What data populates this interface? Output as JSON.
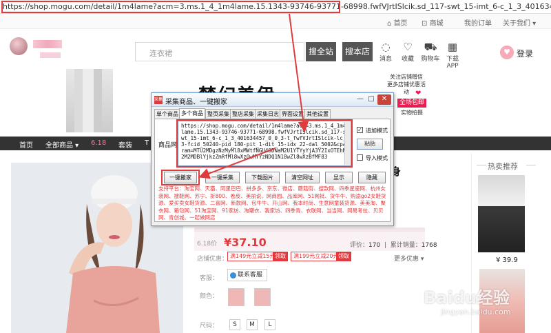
{
  "browser": {
    "url": "https://shop.mogu.com/detail/1m4lame?acm=3.ms.1_4_1m4lame.15.1343-93746-93771-68998.fwfVJrtISlcik.sd_117-swt_15-imt_6-c_1_3_401634457_0_0_3-t_fwfVJrtISlcik-lc_3-fcid_5024..."
  },
  "toplinks": [
    {
      "label": "首页",
      "icon": "home-icon"
    },
    {
      "label": "商城",
      "icon": "cart-icon"
    },
    {
      "label": "我的订单"
    },
    {
      "label": "关于我们"
    }
  ],
  "header": {
    "search_placeholder": "连衣裙",
    "search_all_label": "搜全站",
    "search_shop_label": "搜本店",
    "icons": [
      {
        "label": "消息",
        "icon": "chat-icon",
        "glyph": "◌"
      },
      {
        "label": "收藏",
        "icon": "heart-icon",
        "glyph": "♡"
      },
      {
        "label": "购物车",
        "icon": "cart-icon",
        "glyph": "⛟"
      },
      {
        "label": "下载APP",
        "icon": "qr-icon",
        "glyph": "▦"
      }
    ],
    "login_label": "登录"
  },
  "banner": {
    "title": "梦幻美伊",
    "promo_line1": "关注店铺赠信",
    "promo_line2": "更多店铺优惠活动",
    "promo_button": "全场包邮",
    "promo_sub": "实物拍摄"
  },
  "nav": {
    "items": [
      "首页",
      "全部商品 ▾",
      "6.18",
      "套装",
      "T"
    ]
  },
  "product": {
    "title_tail": "挤修身",
    "price_label": "6.18价",
    "price": "¥37.10",
    "eval_label": "评价：",
    "eval_count": "170",
    "sales_label": "累计销量：",
    "sales_count": "1768",
    "coupon_label": "店铺优惠：",
    "coupons": [
      {
        "text": "满149元立减15元",
        "tag": "领取"
      },
      {
        "text": "满199元立减20元",
        "tag": "领取"
      }
    ],
    "more_label": "更多优惠 ▾",
    "service_label": "客服：",
    "service_button": "联系客服",
    "color_label": "颜色：",
    "size_label": "尺码：",
    "sizes": [
      "S",
      "M",
      "L"
    ]
  },
  "hot": {
    "title": "热卖推荐",
    "price1": "¥ 39.9"
  },
  "dialog": {
    "title": "采集商品、一键搬家",
    "icon_text": "采集",
    "tabs": [
      "单个商品",
      "多个商品",
      "整页采集",
      "整店采集",
      "采集日志",
      "界面设置",
      "其他设置"
    ],
    "url_label": "商品网址:",
    "url_value": "https://shop.mogu.com/detail/1m4lame?acm=3.ms.1_4_1m4lame.15.1343-93746-93771-68998.fwfVJrtISlcik.sd_117-swt_15-imt_6-c_1_3_401634457_0_0_3-t_fwfVJrtISlcik-lc_3-fcid_50240-pid_180-pit_1-dit_15-idx_22-dal_5002&cparam=MTU2MDgzNzMyMl8xMWtfNGU4ODNaM2U1YTYyYjA3Y2IxOTEhN2M2MDBlYjkzZmRfMl8wXzQwMTYzNDQ1N18wZl8wXzBfMF83",
    "add_mode_label": "追加模式",
    "paste_label": "粘贴",
    "import_mode_label": "导入模式",
    "buttons": [
      "一键搬家",
      "一键采集",
      "下载图片",
      "清空网址",
      "显示",
      "隐藏"
    ],
    "platforms": "支持平台：淘宝网、天猫、阿里巴巴、拼多多、京东、微店、蘑菇街、搜款网、四季星座网、杭州女装网、搜鞋网、苏宁、折800、卷皮、美丽说、网商园、品库网、51网批、货牛牛、购途go2女鞋货源、爱买卖女鞋货源、二喜网、新款网、包牛牛、开山网、我本时尚、生意网童装货源、美美淘、聚衣网、箱包网、51淘宝网、91家纺、淘罐衣、我家坊、四季青、衣联网、当当网、网易考拉、贝贝网、青创城、一起做网店"
  },
  "watermark": {
    "main": "Baidu经验",
    "sub": "jingyan.baidu.com"
  }
}
